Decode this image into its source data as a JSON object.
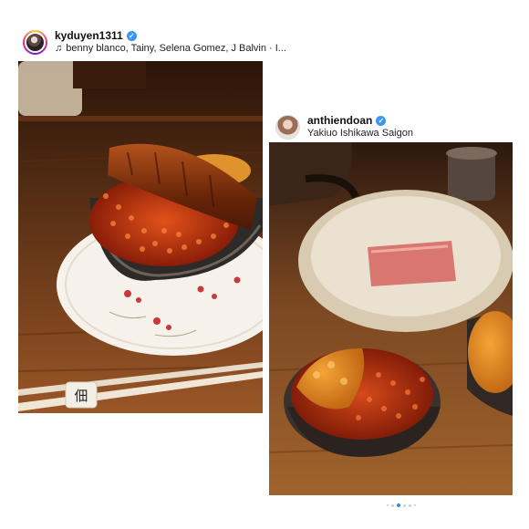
{
  "posts": [
    {
      "username": "kyduyen1311",
      "verified": true,
      "subtitle": "benny blanco, Tainy, Selena Gomez, J Balvin · I...",
      "subtitle_icon": "music-note-icon",
      "photo_desc_icon": "food-photo"
    },
    {
      "username": "anthiendoan",
      "verified": true,
      "subtitle": "Yakiuo Ishikawa Saigon",
      "photo_desc_icon": "food-photo"
    }
  ],
  "carousel": {
    "count": 6,
    "active_index": 2
  },
  "chopstick_rest_text": "佃",
  "colors": {
    "verified": "#3897f0",
    "active_dot": "#2b8cf0"
  }
}
